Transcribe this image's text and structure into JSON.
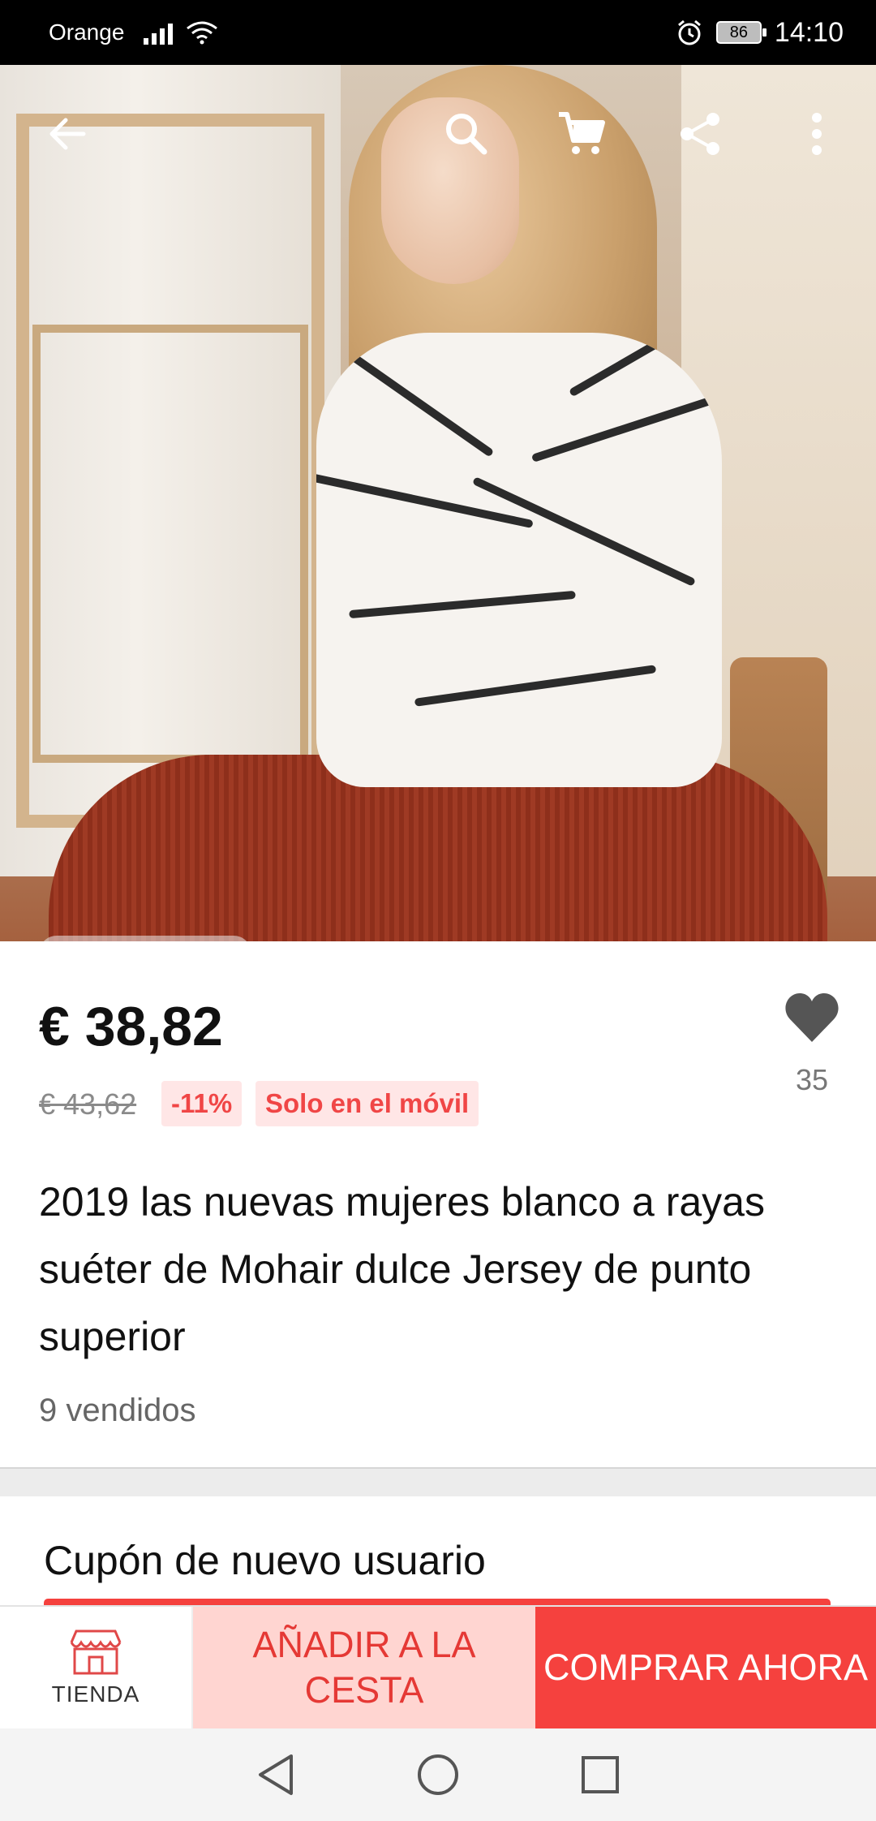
{
  "status_bar": {
    "carrier": "Orange",
    "battery": "86",
    "time": "14:10"
  },
  "top_bar": {
    "icons": [
      "back-arrow-icon",
      "search-icon",
      "cart-icon",
      "share-icon",
      "more-vert-icon"
    ]
  },
  "gallery": {
    "image_count": 6,
    "active_index": 0,
    "active_color": "#f5413e"
  },
  "product": {
    "price": "€ 38,82",
    "original_price": "€ 43,62",
    "discount": "-11%",
    "mobile_only": "Solo en el móvil",
    "wishlist_count": "35",
    "title": "2019 las nuevas mujeres blanco a rayas suéter de Mohair dulce Jersey de punto superior",
    "sold": "9 vendidos"
  },
  "coupon": {
    "title": "Cupón de nuevo usuario"
  },
  "actions": {
    "store_label": "TIENDA",
    "add_to_cart": "AÑADIR A LA CESTA",
    "buy_now": "COMPRAR AHORA"
  },
  "colors": {
    "accent": "#f5413e",
    "add_cart_bg": "#ffd5d1",
    "badge_bg": "#ffe6e6"
  }
}
